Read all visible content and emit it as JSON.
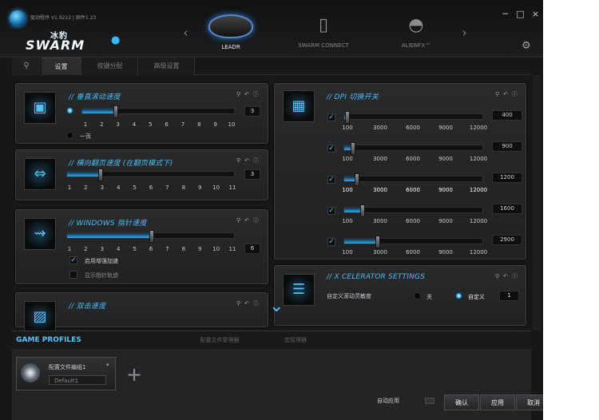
{
  "header": {
    "app_title": "驱动程序 V1.9222 | 固件1.23",
    "brand_cn": "冰豹",
    "brand_en": "SWARM",
    "window_controls": [
      "─",
      "□",
      "×"
    ]
  },
  "devices": [
    {
      "label": "LEADR",
      "active": true,
      "icon": "mouse-icon"
    },
    {
      "label": "SWARM CONNECT",
      "active": false,
      "icon": "phone-icon"
    },
    {
      "label": "ALIENFX™",
      "active": false,
      "icon": "alienfx-icon"
    }
  ],
  "tabs": [
    "设置",
    "按键分配",
    "高级设置"
  ],
  "panels": {
    "vertical": {
      "title": "// 垂直滚动速度",
      "ticks": [
        "1",
        "2",
        "3",
        "4",
        "5",
        "6",
        "7",
        "8",
        "9",
        "10"
      ],
      "value": "3",
      "fraction": 0.22,
      "radio_page": "一页"
    },
    "horizontal": {
      "title": "// 横向翻页速度 (在翻页模式下)",
      "ticks": [
        "1",
        "2",
        "3",
        "4",
        "5",
        "6",
        "7",
        "8",
        "9",
        "10",
        "11"
      ],
      "value": "3",
      "fraction": 0.2
    },
    "pointer": {
      "title": "// WINDOWS 指针速度",
      "ticks": [
        "1",
        "2",
        "3",
        "4",
        "5",
        "6",
        "7",
        "8",
        "9",
        "10",
        "11"
      ],
      "value": "6",
      "fraction": 0.5,
      "enhance": "启用增强加速",
      "trails": "显示指针轨迹"
    },
    "double": {
      "title": "// 双击速度"
    },
    "dpi": {
      "title": "// DPI 切换开关",
      "ticks": [
        "100",
        "3000",
        "6000",
        "9000",
        "12000"
      ],
      "levels": [
        {
          "value": "400",
          "fraction": 0.02
        },
        {
          "value": "900",
          "fraction": 0.06
        },
        {
          "value": "1200",
          "fraction": 0.09,
          "selected": true
        },
        {
          "value": "1600",
          "fraction": 0.13
        },
        {
          "value": "2900",
          "fraction": 0.24
        }
      ]
    },
    "xcelerator": {
      "title": "// X CELERATOR SETTINGS",
      "label": "自定义滚动灵敏度",
      "off": "关",
      "custom": "自定义",
      "value": "1"
    }
  },
  "profiles": {
    "tabs": [
      "GAME PROFILES",
      "配置文件管理器",
      "宏管理器"
    ],
    "name": "配置文件编组1",
    "default": "Default1",
    "auto_apply": "自动应用",
    "buttons": [
      "确认",
      "应用",
      "取消"
    ]
  },
  "colors": {
    "accent": "#4bbcf3",
    "background": "#161718"
  }
}
